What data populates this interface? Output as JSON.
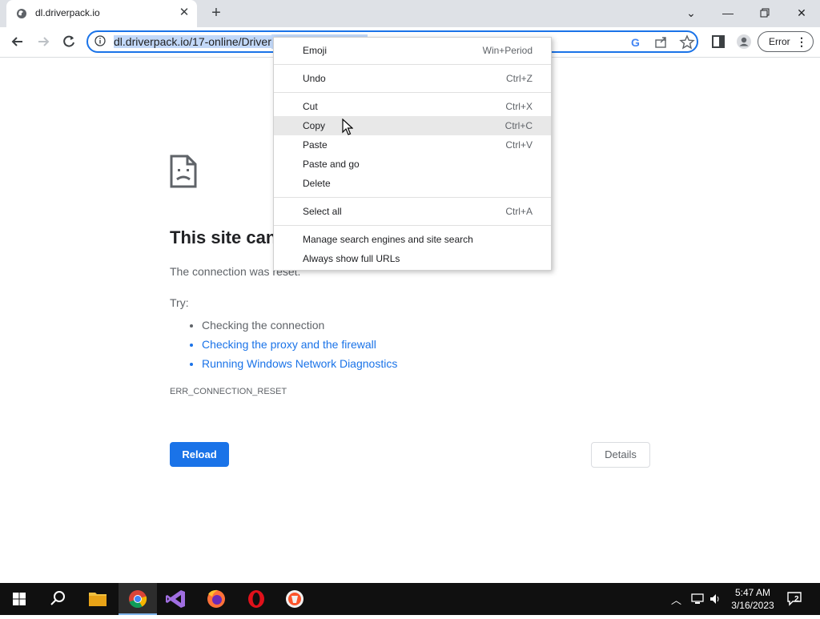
{
  "browser": {
    "tab_title": "dl.driverpack.io",
    "url_text": "dl.driverpack.io/17-online/Driver",
    "error_button_label": "Error"
  },
  "page": {
    "heading": "This site can",
    "reason": "The connection was reset.",
    "try_label": "Try:",
    "suggestions": [
      "Checking the connection",
      "Checking the proxy and the firewall",
      "Running Windows Network Diagnostics"
    ],
    "error_code": "ERR_CONNECTION_RESET",
    "reload_label": "Reload",
    "details_label": "Details"
  },
  "context_menu": {
    "items": [
      {
        "label": "Emoji",
        "shortcut": "Win+Period"
      },
      {
        "label": "Undo",
        "shortcut": "Ctrl+Z"
      },
      {
        "label": "Cut",
        "shortcut": "Ctrl+X"
      },
      {
        "label": "Copy",
        "shortcut": "Ctrl+C"
      },
      {
        "label": "Paste",
        "shortcut": "Ctrl+V"
      },
      {
        "label": "Paste and go",
        "shortcut": ""
      },
      {
        "label": "Delete",
        "shortcut": ""
      },
      {
        "label": "Select all",
        "shortcut": "Ctrl+A"
      },
      {
        "label": "Manage search engines and site search",
        "shortcut": ""
      },
      {
        "label": "Always show full URLs",
        "shortcut": ""
      }
    ],
    "highlighted": "Copy"
  },
  "taskbar": {
    "time": "5:47 AM",
    "date": "3/16/2023",
    "notification_count": "2",
    "apps": [
      "start-icon",
      "search-icon",
      "file-explorer-icon",
      "chrome-icon",
      "visual-studio-icon",
      "firefox-icon",
      "opera-icon",
      "brave-icon"
    ]
  },
  "colors": {
    "accent": "#1a73e8",
    "tabstrip": "#dee1e6",
    "taskbar": "#101010"
  }
}
